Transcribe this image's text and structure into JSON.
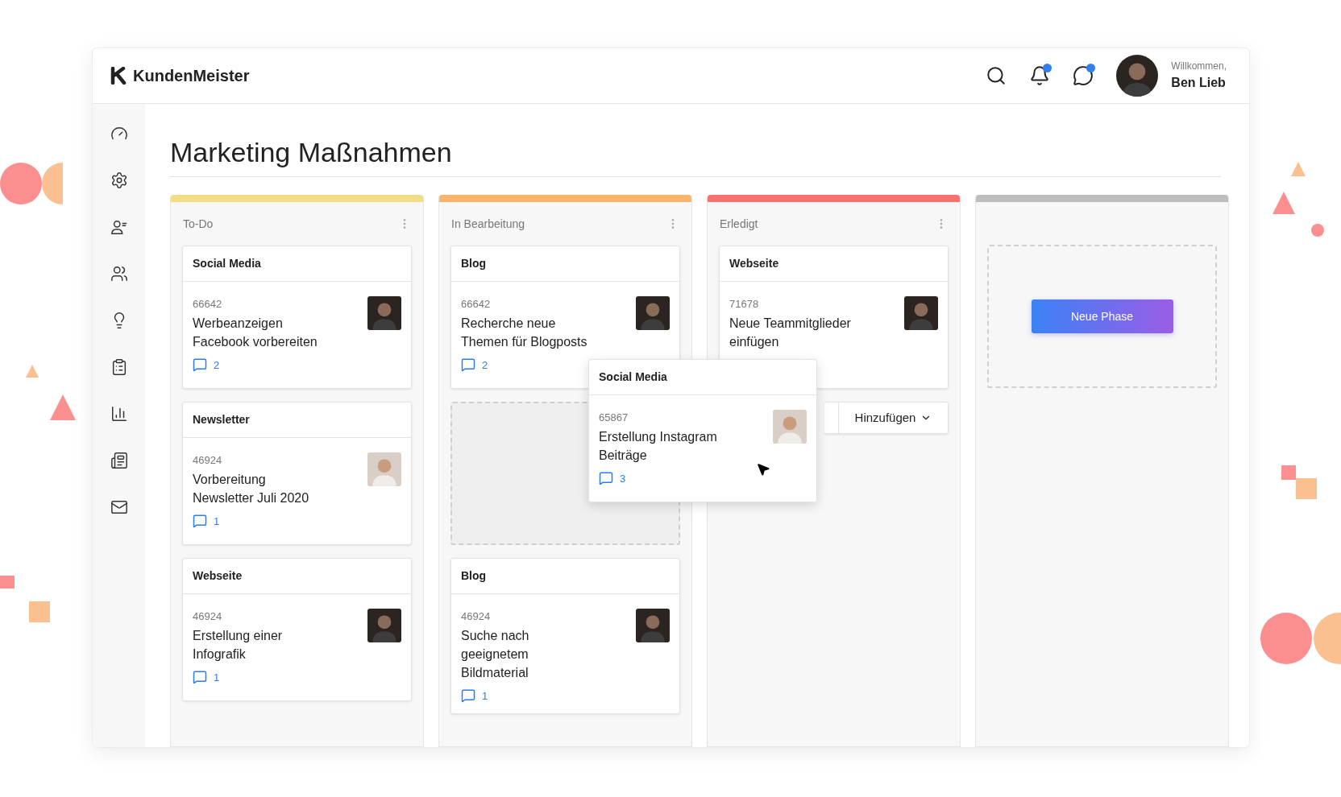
{
  "header": {
    "app_name": "KundenMeister",
    "actions": [
      {
        "kind": "search",
        "unread": false
      },
      {
        "kind": "notifications",
        "unread": true
      },
      {
        "kind": "messages",
        "unread": true
      }
    ],
    "greeting": "Willkommen,",
    "user_name": "Ben Lieb"
  },
  "sidebar": {
    "items": [
      {
        "kind": "dashboard"
      },
      {
        "kind": "settings"
      },
      {
        "kind": "contacts"
      },
      {
        "kind": "team"
      },
      {
        "kind": "ideas"
      },
      {
        "kind": "tasks"
      },
      {
        "kind": "reports"
      },
      {
        "kind": "documents"
      },
      {
        "kind": "mail"
      }
    ]
  },
  "page_title": "Marketing Maßnahmen",
  "columns": [
    {
      "kind": "phase",
      "title": "To-Do",
      "color": "#f3dc86",
      "items": [
        {
          "kind": "card",
          "category": "Social Media",
          "id": "66642",
          "title": "Werbeanzeigen Facebook vorbereiten",
          "comments": "2"
        },
        {
          "kind": "card",
          "category": "Newsletter",
          "id": "46924",
          "title": "Vorbereitung Newsletter Juli 2020",
          "comments": "1"
        },
        {
          "kind": "card",
          "category": "Webseite",
          "id": "46924",
          "title": "Erstellung einer Infografik",
          "comments": "1"
        }
      ]
    },
    {
      "kind": "phase",
      "title": "In Bearbeitung",
      "color": "#fbb56b",
      "items": [
        {
          "kind": "card",
          "category": "Blog",
          "id": "66642",
          "title": "Recherche neue Themen für Blogposts",
          "comments": "2"
        },
        {
          "kind": "drop-zone"
        },
        {
          "kind": "card",
          "category": "Blog",
          "id": "46924",
          "title": "Suche nach geeignetem Bildmaterial",
          "comments": "1"
        }
      ]
    },
    {
      "kind": "phase",
      "title": "Erledigt",
      "color": "#f7716f",
      "items": [
        {
          "kind": "card",
          "category": "Webseite",
          "id": "71678",
          "title": "Neue Teammitglieder einfügen"
        },
        {
          "kind": "add",
          "label": "Hinzufügen"
        }
      ]
    },
    {
      "kind": "new-phase",
      "color": "#bdbdbd",
      "button": "Neue Phase"
    }
  ],
  "dragged_card": {
    "category": "Social Media",
    "id": "65867",
    "title": "Erstellung Instagram Beiträge",
    "comments": "3"
  }
}
